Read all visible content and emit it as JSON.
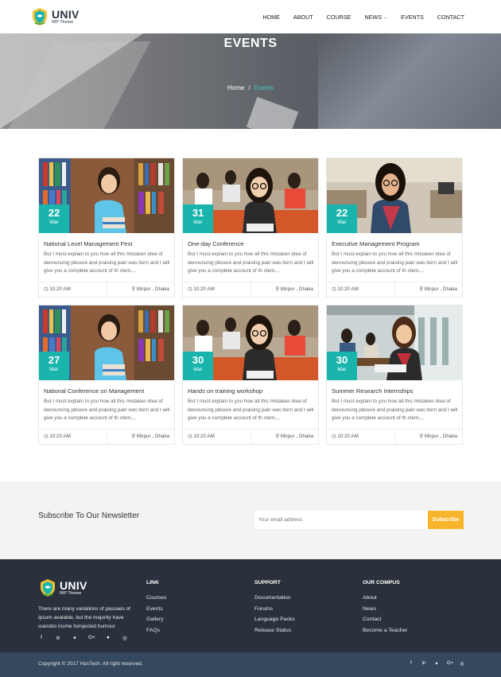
{
  "brand": {
    "name": "UNIV",
    "tagline": "WP Theme"
  },
  "nav": [
    "HOME",
    "ABOUT",
    "COURSE",
    "NEWS",
    "EVENTS",
    "CONTACT"
  ],
  "hero": {
    "title": "EVENTS",
    "breadcrumb_home": "Home",
    "breadcrumb_sep": "/",
    "breadcrumb_current": "Events"
  },
  "events": [
    {
      "day": "22",
      "month": "Mar",
      "title": "National Level Management Fest",
      "desc": "But I must explain to you how all this mistaken idea of denouncing plesure and praising pain was born and I will give you a complete account of th stem,...",
      "time": "10:20 AM",
      "location": "Mirpur , Dhaka"
    },
    {
      "day": "31",
      "month": "Mar",
      "title": "One-day Conference",
      "desc": "But I must explain to you how all this mistaken idea of denouncing plesure and praising pain was born and I will give you a complete account of th stem,...",
      "time": "10:20 AM",
      "location": "Mirpur , Dhaka"
    },
    {
      "day": "22",
      "month": "Mar",
      "title": "Executive Management Program",
      "desc": "But I must explain to you how all this mistaken idea of denouncing plesure and praising pain was born and I will give you a complete account of th stem,...",
      "time": "10:20 AM",
      "location": "Mirpur , Dhaka"
    },
    {
      "day": "27",
      "month": "Mar",
      "title": "National Conference on Management",
      "desc": "But I must explain to you how all this mistaken idea of denouncing plesure and praising pain was born and I will give you a complete account of th stem,...",
      "time": "10:20 AM",
      "location": "Mirpur , Dhaka"
    },
    {
      "day": "30",
      "month": "Mar",
      "title": "Hands on training workshop",
      "desc": "But I must explain to you how all this mistaken idea of denouncing plesure and praising pain was born and I will give you a complete account of th stem,...",
      "time": "10:20 AM",
      "location": "Mirpur , Dhaka"
    },
    {
      "day": "30",
      "month": "Mar",
      "title": "Summer Research Internships",
      "desc": "But I must explain to you how all this mistaken idea of denouncing plesure and praising pain was born and I will give you a complete account of th stem,...",
      "time": "10:20 AM",
      "location": "Mirpur , Dhaka"
    }
  ],
  "newsletter": {
    "title": "Subscribe To Our Newsletter",
    "placeholder": "Your email address",
    "button": "Subscribe"
  },
  "footer": {
    "about": "There are many variations of passaes of Ipsum avalable, but the majority have sueratio inome fornjected humour",
    "columns": [
      {
        "title": "LINK",
        "links": [
          "Courses",
          "Events",
          "Gallery",
          "FAQs"
        ]
      },
      {
        "title": "SUPPORT",
        "links": [
          "Documentation",
          "Forums",
          "Language Packs",
          "Release Status"
        ]
      },
      {
        "title": "OUR COMPUS",
        "links": [
          "About",
          "News",
          "Contact",
          "Become a Teacher"
        ]
      }
    ],
    "social_icons": [
      "facebook-icon",
      "rss-icon",
      "twitter-icon",
      "google-plus-icon",
      "pinterest-icon",
      "instagram-icon"
    ],
    "copyright": "Copyright © 2017 HasTech. All right reserved."
  },
  "colors": {
    "accent": "#19b5ac",
    "subscribe": "#f8b52c",
    "footer_bg": "#2a313c",
    "bottom_bar": "#34495e"
  }
}
